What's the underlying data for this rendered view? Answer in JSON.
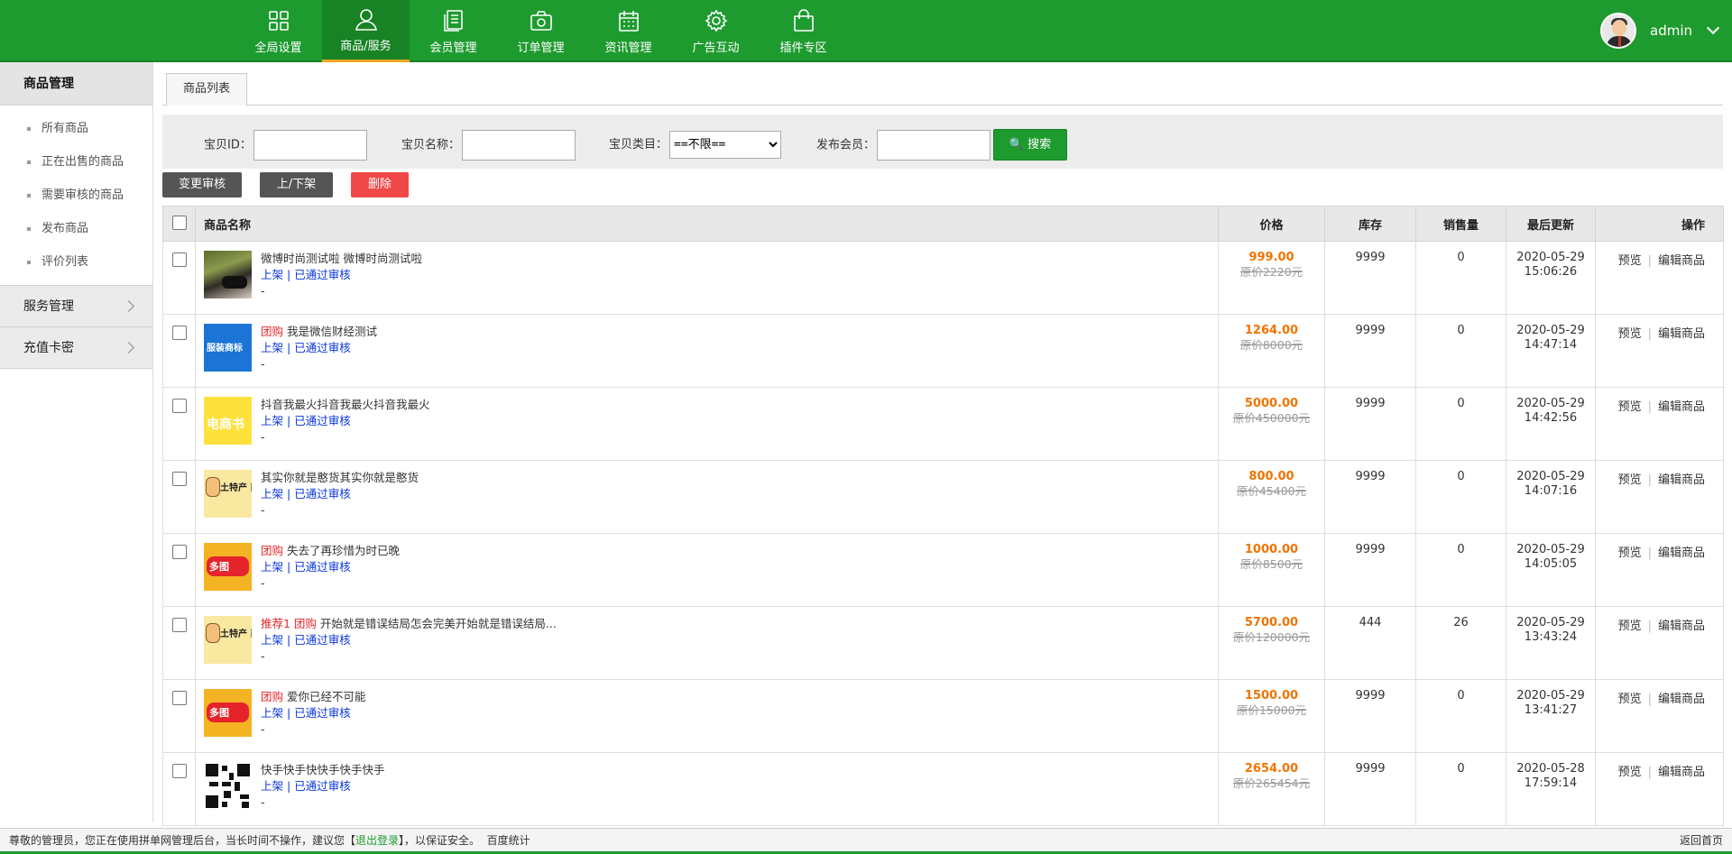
{
  "nav": {
    "items": [
      {
        "label": "全局设置",
        "icon": "grid-icon"
      },
      {
        "label": "商品/服务",
        "icon": "user-icon"
      },
      {
        "label": "会员管理",
        "icon": "book-icon"
      },
      {
        "label": "订单管理",
        "icon": "camera-icon"
      },
      {
        "label": "资讯管理",
        "icon": "calendar-icon"
      },
      {
        "label": "广告互动",
        "icon": "gear-icon"
      },
      {
        "label": "插件专区",
        "icon": "bag-icon"
      }
    ],
    "active_index": 1,
    "user": "admin"
  },
  "sidebar": {
    "section_title": "商品管理",
    "items": [
      "所有商品",
      "正在出售的商品",
      "需要审核的商品",
      "发布商品",
      "评价列表"
    ],
    "groups": [
      "服务管理",
      "充值卡密"
    ]
  },
  "tab": {
    "label": "商品列表"
  },
  "search": {
    "id_label": "宝贝ID：",
    "name_label": "宝贝名称：",
    "category_label": "宝贝类目：",
    "category_value": "==不限==",
    "member_label": "发布会员：",
    "button": "搜索"
  },
  "actions": {
    "review": "变更审核",
    "onoff": "上/下架",
    "delete": "删除"
  },
  "table": {
    "headers": {
      "name": "商品名称",
      "price": "价格",
      "stock": "库存",
      "sales": "销售量",
      "updated": "最后更新",
      "ops": "操作"
    },
    "rows": [
      {
        "thumb": "photo",
        "tags": "",
        "title": "微博时尚测试啦 微博时尚测试啦",
        "shelf": "上架",
        "review": "已通过审核",
        "dash": "-",
        "price": "999.00",
        "orig": "原价2220元",
        "stock": "9999",
        "sales": "0",
        "date": "2020-05-29",
        "time": "15:06:26",
        "op1": "预览",
        "op2": "编辑商品"
      },
      {
        "thumb": "blue",
        "thumb_text": "服装商标",
        "tags": "团购",
        "title": "我是微信财经测试",
        "shelf": "上架",
        "review": "已通过审核",
        "dash": "-",
        "price": "1264.00",
        "orig": "原价8000元",
        "stock": "9999",
        "sales": "0",
        "date": "2020-05-29",
        "time": "14:47:14",
        "op1": "预览",
        "op2": "编辑商品"
      },
      {
        "thumb": "yellow",
        "thumb_text": "电商书",
        "tags": "",
        "title": "抖音我最火抖音我最火抖音我最火",
        "shelf": "上架",
        "review": "已通过审核",
        "dash": "-",
        "price": "5000.00",
        "orig": "原价450000元",
        "stock": "9999",
        "sales": "0",
        "date": "2020-05-29",
        "time": "14:42:56",
        "op1": "预览",
        "op2": "编辑商品"
      },
      {
        "thumb": "cartoon",
        "thumb_text": "土特产 商标注",
        "tags": "",
        "title": "其实你就是憨货其实你就是憨货",
        "shelf": "上架",
        "review": "已通过审核",
        "dash": "-",
        "price": "800.00",
        "orig": "原价45400元",
        "stock": "9999",
        "sales": "0",
        "date": "2020-05-29",
        "time": "14:07:16",
        "op1": "预览",
        "op2": "编辑商品"
      },
      {
        "thumb": "red",
        "thumb_text": "多图",
        "tags": "团购",
        "title": "失去了再珍惜为时已晚",
        "shelf": "上架",
        "review": "已通过审核",
        "dash": "-",
        "price": "1000.00",
        "orig": "原价8500元",
        "stock": "9999",
        "sales": "0",
        "date": "2020-05-29",
        "time": "14:05:05",
        "op1": "预览",
        "op2": "编辑商品"
      },
      {
        "thumb": "cartoon",
        "thumb_text": "土特产 商标注",
        "tags": "推荐1 团购",
        "title": "开始就是错误结局怎会完美开始就是错误结局...",
        "shelf": "上架",
        "review": "已通过审核",
        "dash": "-",
        "price": "5700.00",
        "orig": "原价120000元",
        "stock": "444",
        "sales": "26",
        "date": "2020-05-29",
        "time": "13:43:24",
        "op1": "预览",
        "op2": "编辑商品"
      },
      {
        "thumb": "red",
        "thumb_text": "多图",
        "tags": "团购",
        "title": "爱你已经不可能",
        "shelf": "上架",
        "review": "已通过审核",
        "dash": "-",
        "price": "1500.00",
        "orig": "原价15000元",
        "stock": "9999",
        "sales": "0",
        "date": "2020-05-29",
        "time": "13:41:27",
        "op1": "预览",
        "op2": "编辑商品"
      },
      {
        "thumb": "qr",
        "tags": "",
        "title": "快手快手快快手快手快手",
        "shelf": "上架",
        "review": "已通过审核",
        "dash": "-",
        "price": "2654.00",
        "orig": "原价265454元",
        "stock": "9999",
        "sales": "0",
        "date": "2020-05-28",
        "time": "17:59:14",
        "op1": "预览",
        "op2": "编辑商品"
      }
    ]
  },
  "footer": {
    "text_before": "尊敬的管理员，您正在使用拼单网管理后台，当长时间不操作，建议您【",
    "logout": "退出登录",
    "text_after": "】，以保证安全。  百度统计",
    "home": "返回首页"
  },
  "colors": {
    "brand": "#1e9b2f",
    "price": "#f27300",
    "tag": "#e6282c",
    "link": "#0a36d8"
  }
}
